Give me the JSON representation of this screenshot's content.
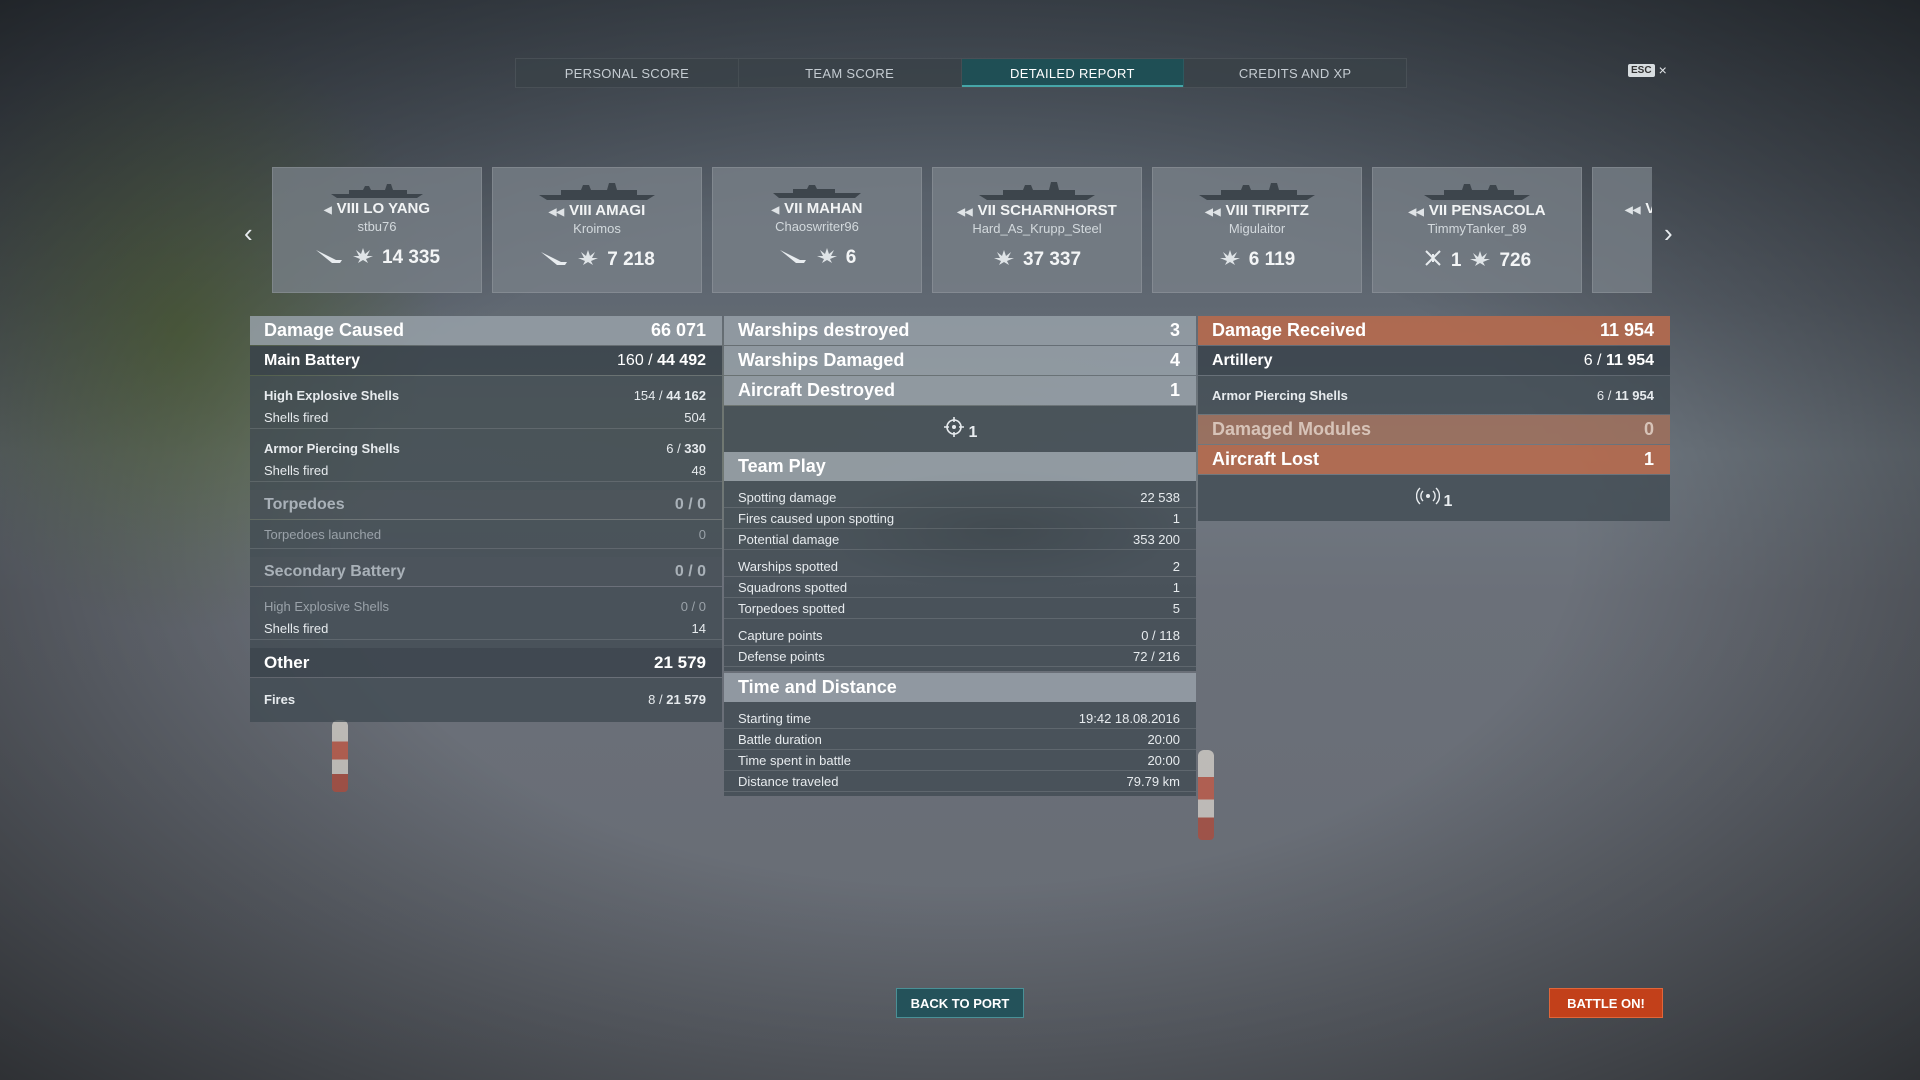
{
  "tabs": [
    {
      "label": "PERSONAL SCORE",
      "active": false
    },
    {
      "label": "TEAM SCORE",
      "active": false
    },
    {
      "label": "DETAILED REPORT",
      "active": true
    },
    {
      "label": "CREDITS AND XP",
      "active": false
    }
  ],
  "esc": {
    "key": "ESC",
    "close": "×"
  },
  "nav": {
    "prev": "‹",
    "next": "›"
  },
  "ships": [
    {
      "tier": "VIII",
      "name": "LO YANG",
      "player": "stbu76",
      "damage": "14 335",
      "extra": ""
    },
    {
      "tier": "VIII",
      "name": "AMAGI",
      "player": "Kroimos",
      "damage": "7 218",
      "extra": ""
    },
    {
      "tier": "VII",
      "name": "MAHAN",
      "player": "Chaoswriter96",
      "damage": "6",
      "extra": ""
    },
    {
      "tier": "VII",
      "name": "SCHARNHORST",
      "player": "Hard_As_Krupp_Steel",
      "damage": "37 337",
      "extra": ""
    },
    {
      "tier": "VIII",
      "name": "TIRPITZ",
      "player": "Migulaitor",
      "damage": "6 119",
      "extra": ""
    },
    {
      "tier": "VII",
      "name": "PENSACOLA",
      "player": "TimmyTanker_89",
      "damage": "726",
      "extra": "1"
    },
    {
      "tier": "VI",
      "name": "",
      "player": "",
      "damage": "",
      "extra": ""
    }
  ],
  "left": {
    "damage_caused": {
      "label": "Damage Caused",
      "value": "66 071"
    },
    "main_battery": {
      "label": "Main Battery",
      "value_a": "160",
      "value_b": "44 492"
    },
    "he_shells": {
      "label": "High Explosive Shells",
      "value_a": "154",
      "value_b": "44 162"
    },
    "he_fired": {
      "label": "Shells fired",
      "value": "504"
    },
    "ap_shells": {
      "label": "Armor Piercing Shells",
      "value_a": "6",
      "value_b": "330"
    },
    "ap_fired": {
      "label": "Shells fired",
      "value": "48"
    },
    "torpedoes": {
      "label": "Torpedoes",
      "value": "0 / 0"
    },
    "torps_launched": {
      "label": "Torpedoes launched",
      "value": "0"
    },
    "secondary": {
      "label": "Secondary Battery",
      "value": "0 / 0"
    },
    "sec_he": {
      "label": "High Explosive Shells",
      "value": "0 / 0"
    },
    "sec_fired": {
      "label": "Shells fired",
      "value": "14"
    },
    "other": {
      "label": "Other",
      "value": "21 579"
    },
    "fires": {
      "label": "Fires",
      "value_a": "8",
      "value_b": "21 579"
    }
  },
  "middle": {
    "warships_destroyed": {
      "label": "Warships destroyed",
      "value": "3"
    },
    "warships_damaged": {
      "label": "Warships Damaged",
      "value": "4"
    },
    "aircraft_destroyed": {
      "label": "Aircraft Destroyed",
      "value": "1"
    },
    "aircraft_icon_count": "1",
    "team_play": {
      "title": "Team Play",
      "rows": [
        {
          "label": "Spotting damage",
          "value": "22 538"
        },
        {
          "label": "Fires caused upon spotting",
          "value": "1"
        },
        {
          "label": "Potential damage",
          "value": "353 200"
        },
        {
          "label": "Warships spotted",
          "value": "2"
        },
        {
          "label": "Squadrons spotted",
          "value": "1"
        },
        {
          "label": "Torpedoes spotted",
          "value": "5"
        },
        {
          "label": "Capture points",
          "value": "0 / 118"
        },
        {
          "label": "Defense points",
          "value": "72 / 216"
        }
      ]
    },
    "time": {
      "title": "Time and Distance",
      "rows": [
        {
          "label": "Starting time",
          "value": "19:42  18.08.2016"
        },
        {
          "label": "Battle duration",
          "value": "20:00"
        },
        {
          "label": "Time spent in battle",
          "value": "20:00"
        },
        {
          "label": "Distance traveled",
          "value": "79.79 km"
        }
      ]
    }
  },
  "right": {
    "damage_received": {
      "label": "Damage Received",
      "value": "11 954"
    },
    "artillery": {
      "label": "Artillery",
      "value_a": "6",
      "value_b": "11 954"
    },
    "ap_shells": {
      "label": "Armor Piercing Shells",
      "value_a": "6",
      "value_b": "11 954"
    },
    "damaged_modules": {
      "label": "Damaged Modules",
      "value": "0"
    },
    "aircraft_lost": {
      "label": "Aircraft Lost",
      "value": "1"
    },
    "radio_icon_count": "1"
  },
  "buttons": {
    "back": "BACK TO PORT",
    "battle": "BATTLE ON!"
  }
}
